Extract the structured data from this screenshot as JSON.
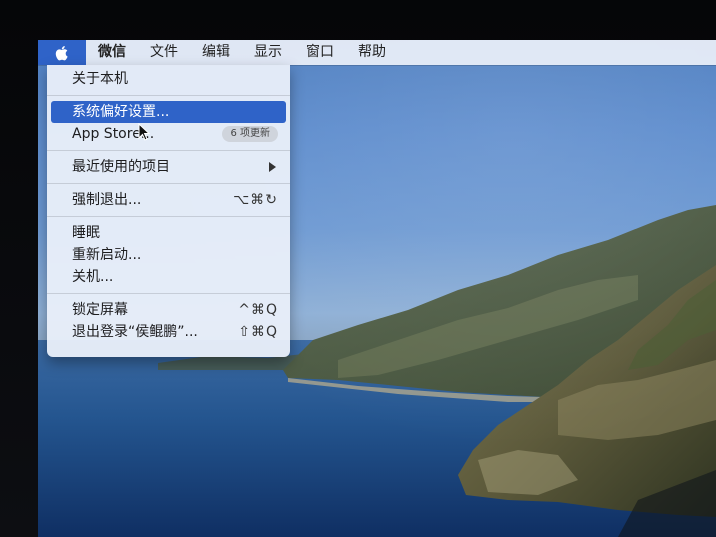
{
  "menubar": {
    "apple_icon": "apple-logo-icon",
    "items": [
      "微信",
      "文件",
      "编辑",
      "显示",
      "窗口",
      "帮助"
    ]
  },
  "apple_menu": {
    "about": "关于本机",
    "preferences": "系统偏好设置...",
    "app_store": "App Store...",
    "app_store_badge": "6 项更新",
    "recent_items": "最近使用的项目",
    "force_quit": "强制退出...",
    "force_quit_shortcut": "⌥⌘↻",
    "sleep": "睡眠",
    "restart": "重新启动...",
    "shutdown": "关机...",
    "lock_screen": "锁定屏幕",
    "lock_screen_shortcut": "^⌘Q",
    "logout": "退出登录“侯鲲鹏”...",
    "logout_shortcut": "⇧⌘Q"
  },
  "colors": {
    "highlight": "#2f63c8",
    "menu_bg": "#e8eef9",
    "menubar_bg": "#ecf0f8"
  }
}
